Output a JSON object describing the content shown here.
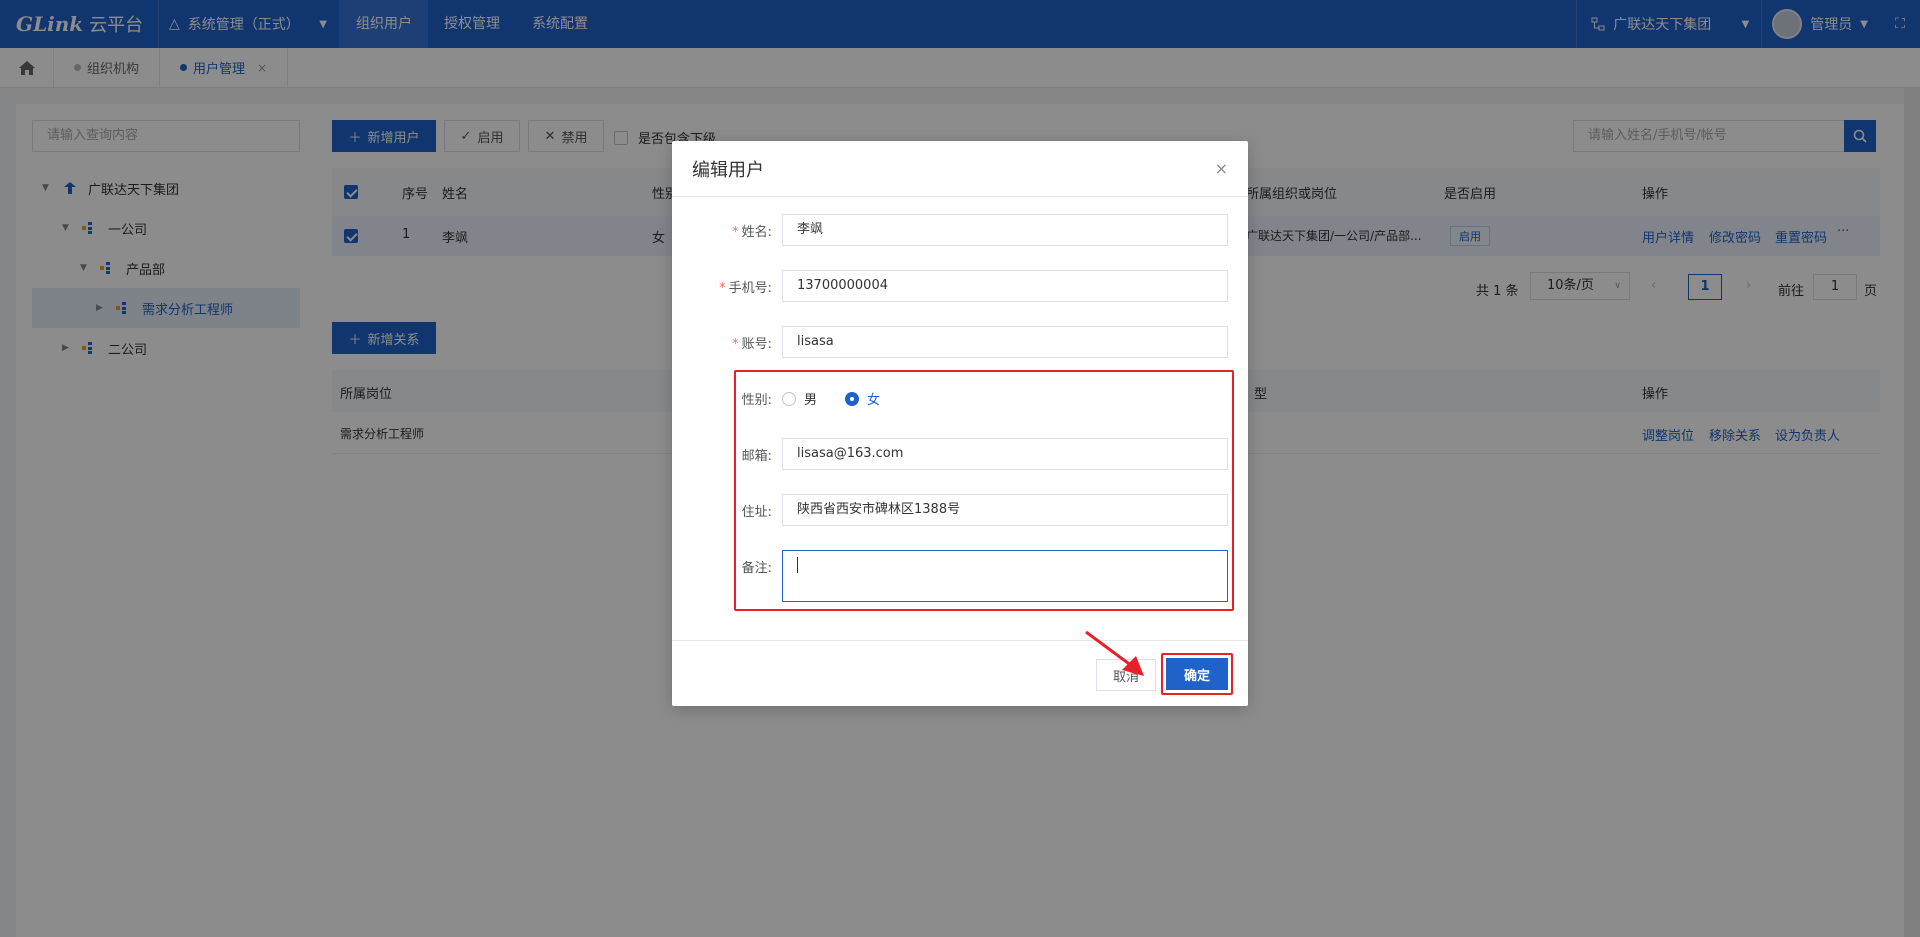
{
  "topbar": {
    "logo_brand": "GLink",
    "logo_cn": "云平台",
    "system_select": "系统管理（正式）",
    "nav": [
      "组织用户",
      "授权管理",
      "系统配置"
    ],
    "org_select": "广联达天下集团",
    "user": "管理员"
  },
  "tabs": {
    "items": [
      {
        "label": "组织机构"
      },
      {
        "label": "用户管理",
        "close": "×"
      }
    ]
  },
  "left": {
    "search_placeholder": "请输入查询内容",
    "tree": [
      {
        "label": "广联达天下集团"
      },
      {
        "label": "一公司"
      },
      {
        "label": "产品部"
      },
      {
        "label": "需求分析工程师"
      },
      {
        "label": "二公司"
      }
    ]
  },
  "toolbar": {
    "add_user": "新增用户",
    "enable": "启用",
    "disable": "禁用",
    "include_sub": "是否包含下级",
    "search_placeholder": "请输入姓名/手机号/帐号"
  },
  "user_table": {
    "headers": {
      "seq": "序号",
      "name": "姓名",
      "gender": "性别",
      "org": "所属组织或岗位",
      "enabled": "是否启用",
      "ops": "操作"
    },
    "row": {
      "seq": "1",
      "name": "李飒",
      "gender": "女",
      "org": "广联达天下集团/一公司/产品部...",
      "enabled": "启用",
      "op1": "用户详情",
      "op2": "修改密码",
      "op3": "重置密码",
      "more": "···"
    }
  },
  "pagination": {
    "total": "共 1 条",
    "page_size": "10条/页",
    "current": "1",
    "goto": "前往",
    "goto_value": "1",
    "page_unit": "页"
  },
  "relation": {
    "add_button": "新增关系",
    "headers": {
      "post": "所属岗位",
      "type": "型",
      "ops": "操作"
    },
    "row": {
      "post": "需求分析工程师",
      "op1": "调整岗位",
      "op2": "移除关系",
      "op3": "设为负责人"
    }
  },
  "modal": {
    "title": "编辑用户",
    "close": "×",
    "fields": {
      "name_label": "姓名:",
      "name_value": "李飒",
      "phone_label": "手机号:",
      "phone_value": "13700000004",
      "account_label": "账号:",
      "account_value": "lisasa",
      "gender_label": "性别:",
      "male": "男",
      "female": "女",
      "email_label": "邮箱:",
      "email_value": "lisasa@163.com",
      "address_label": "住址:",
      "address_value": "陕西省西安市碑林区1388号",
      "note_label": "备注:",
      "note_value": ""
    },
    "required_mark": "*",
    "cancel": "取消",
    "confirm": "确定"
  },
  "colors": {
    "primary": "#1f62c9",
    "highlight": "#e8202a"
  }
}
